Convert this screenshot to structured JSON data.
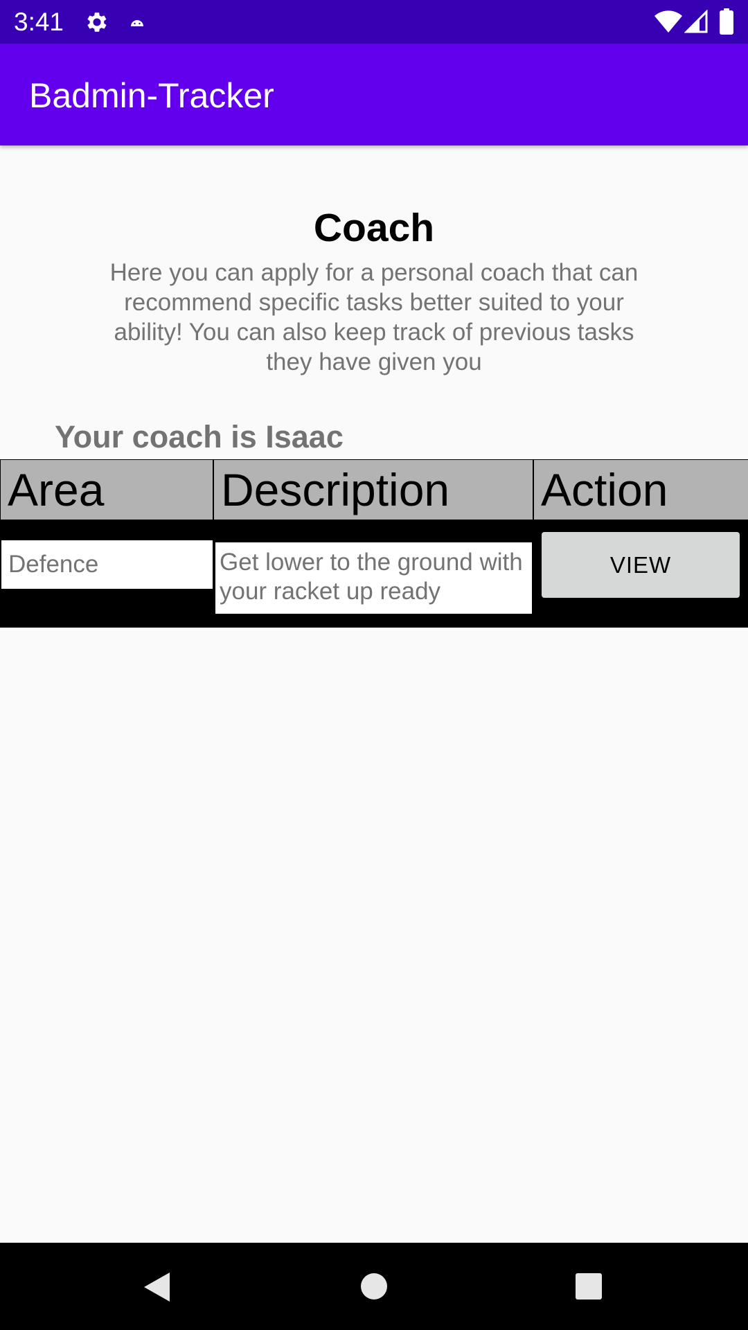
{
  "status_bar": {
    "time": "3:41",
    "icons": [
      "gear-icon",
      "android-icon",
      "wifi-icon",
      "signal-icon",
      "battery-icon"
    ]
  },
  "app_bar": {
    "title": "Badmin-Tracker"
  },
  "main": {
    "heading": "Coach",
    "intro": "Here you can apply for a personal coach that can recommend specific tasks better suited to your ability! You can also keep track of previous tasks they have given you",
    "coach_label": "Your coach is Isaac"
  },
  "table": {
    "headers": [
      "Area",
      "Description",
      "Action"
    ],
    "rows": [
      {
        "area": "Defence",
        "description": "Get lower to the ground with your racket up ready",
        "action_label": "VIEW"
      }
    ]
  },
  "nav_bar": {
    "icons": [
      "back-icon",
      "home-icon",
      "recents-icon"
    ]
  },
  "colors": {
    "status_bar": "#3700b3",
    "app_bar": "#6200ee",
    "background": "#fafafa",
    "table_header": "#b3b3b3",
    "table_border": "#000000",
    "button": "#d6d7d7",
    "muted_text": "#737373"
  }
}
